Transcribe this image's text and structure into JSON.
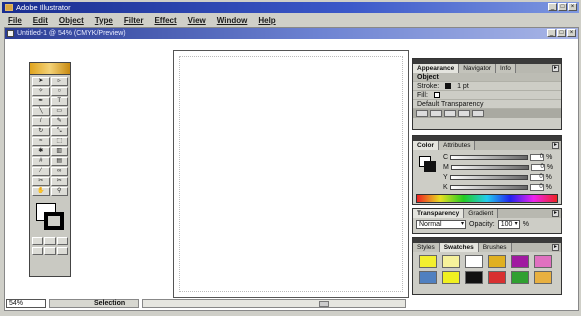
{
  "app": {
    "title": "Adobe Illustrator"
  },
  "menu": [
    "File",
    "Edit",
    "Object",
    "Type",
    "Filter",
    "Effect",
    "View",
    "Window",
    "Help"
  ],
  "document": {
    "title": "Untitled-1 @ 54% (CMYK/Preview)"
  },
  "window_buttons": {
    "minimize": "_",
    "maximize": "□",
    "close": "×"
  },
  "status": {
    "zoom": "54%",
    "tool": "Selection"
  },
  "appearance": {
    "tabs": [
      "Appearance",
      "Navigator",
      "Info"
    ],
    "rows": {
      "object": "Object",
      "stroke_label": "Stroke:",
      "stroke_value": "1 pt",
      "fill_label": "Fill:",
      "transparency": "Default Transparency"
    }
  },
  "color": {
    "tabs": [
      "Color",
      "Attributes"
    ],
    "channels": [
      {
        "label": "C",
        "value": "0"
      },
      {
        "label": "M",
        "value": "0"
      },
      {
        "label": "Y",
        "value": "0"
      },
      {
        "label": "K",
        "value": "0"
      }
    ],
    "unit": "%"
  },
  "transparency": {
    "tabs": [
      "Transparency",
      "Gradient"
    ],
    "mode": "Normal",
    "opacity_label": "Opacity:",
    "opacity_value": "100",
    "unit": "%"
  },
  "swatches_panel": {
    "tabs": [
      "Styles",
      "Swatches",
      "Brushes"
    ],
    "colors": [
      "#f3ef2f",
      "#f6f19b",
      "#ffffff",
      "#e0b020",
      "#a01aa0",
      "#e070c0",
      "#5080c0",
      "#f0f020",
      "#111111",
      "#d83030",
      "#30a030",
      "#e8b040"
    ]
  },
  "colors": {
    "title_bar": "#1a2e8f",
    "doc_title_bar": "#2a3c95"
  }
}
